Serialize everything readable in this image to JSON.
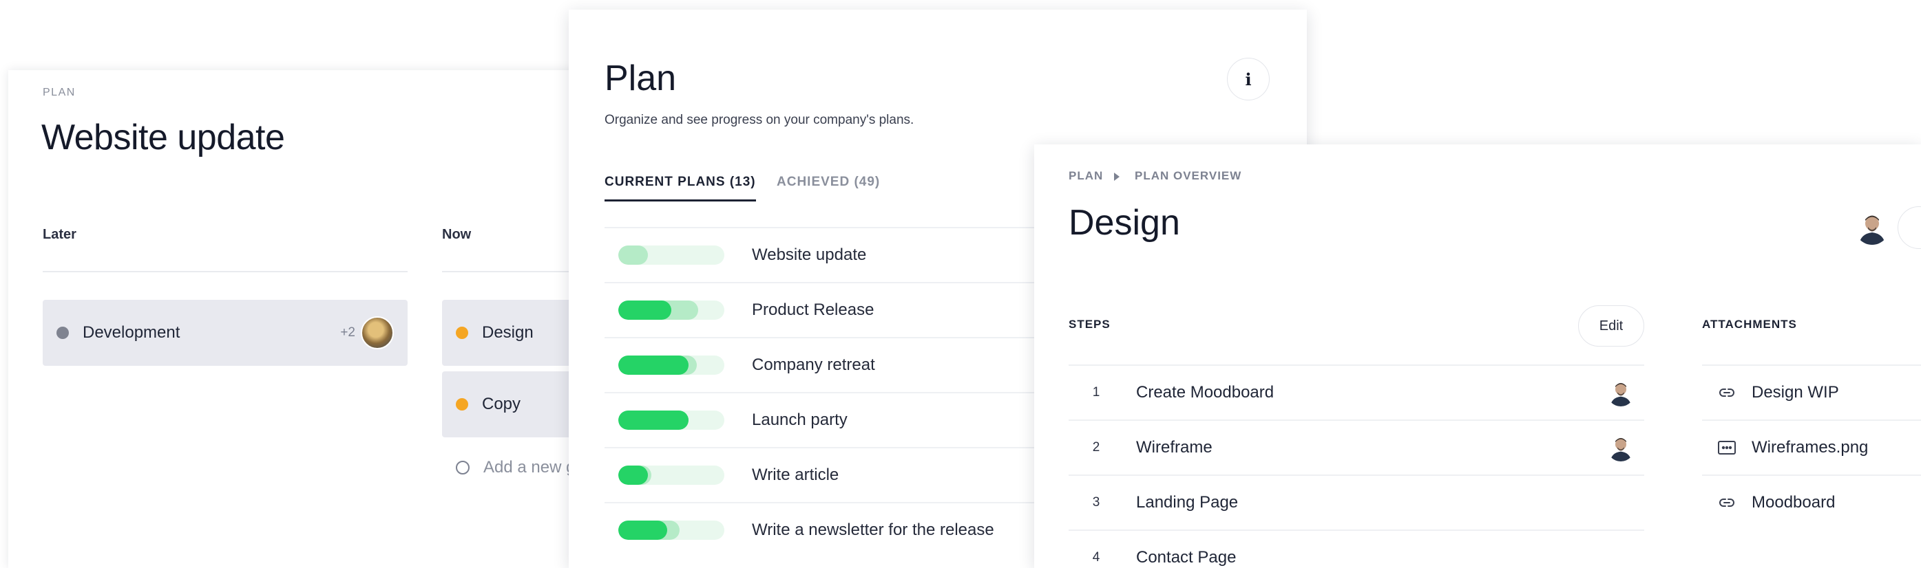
{
  "board": {
    "kicker": "PLAN",
    "title": "Website update",
    "columns": [
      {
        "title": "Later"
      },
      {
        "title": "Now"
      }
    ],
    "goals": [
      {
        "label": "Development",
        "more": "+2",
        "color": "#7f8390"
      },
      {
        "label": "Design",
        "color": "#f5a623"
      },
      {
        "label": "Copy",
        "color": "#f5a623"
      }
    ],
    "add_goal": "Add a new g"
  },
  "plan": {
    "title": "Plan",
    "subtitle": "Organize and see progress on your company's plans.",
    "info_glyph": "i",
    "tabs": [
      {
        "label": "CURRENT PLANS (13)",
        "active": true
      },
      {
        "label": "ACHIEVED (49)",
        "active": false
      }
    ],
    "rows": [
      {
        "name": "Website update",
        "done": 0,
        "progress": 0.28
      },
      {
        "name": "Product Release",
        "done": 0.5,
        "progress": 0.75
      },
      {
        "name": "Company retreat",
        "done": 0.66,
        "progress": 0.74
      },
      {
        "name": "Launch party",
        "done": 0.66,
        "progress": 0.66
      },
      {
        "name": "Write article",
        "done": 0.28,
        "progress": 0.31
      },
      {
        "name": "Write a newsletter for the release",
        "done": 0.46,
        "progress": 0.58
      }
    ],
    "colors": {
      "done": "#25d366",
      "progress": "#b5ebc7",
      "track": "#e9f8ee"
    }
  },
  "design": {
    "breadcrumb": [
      "PLAN",
      "PLAN OVERVIEW"
    ],
    "title": "Design",
    "steps_title": "STEPS",
    "edit_label": "Edit",
    "steps": [
      {
        "num": "1",
        "name": "Create Moodboard",
        "has_avatar": true
      },
      {
        "num": "2",
        "name": "Wireframe",
        "has_avatar": true
      },
      {
        "num": "3",
        "name": "Landing Page",
        "has_avatar": false
      },
      {
        "num": "4",
        "name": "Contact Page",
        "has_avatar": false
      }
    ],
    "attachments_title": "ATTACHMENTS",
    "attachments": [
      {
        "name": "Design WIP",
        "icon": "link-icon"
      },
      {
        "name": "Wireframes.png",
        "icon": "image-file-icon"
      },
      {
        "name": "Moodboard",
        "icon": "link-icon"
      }
    ]
  }
}
